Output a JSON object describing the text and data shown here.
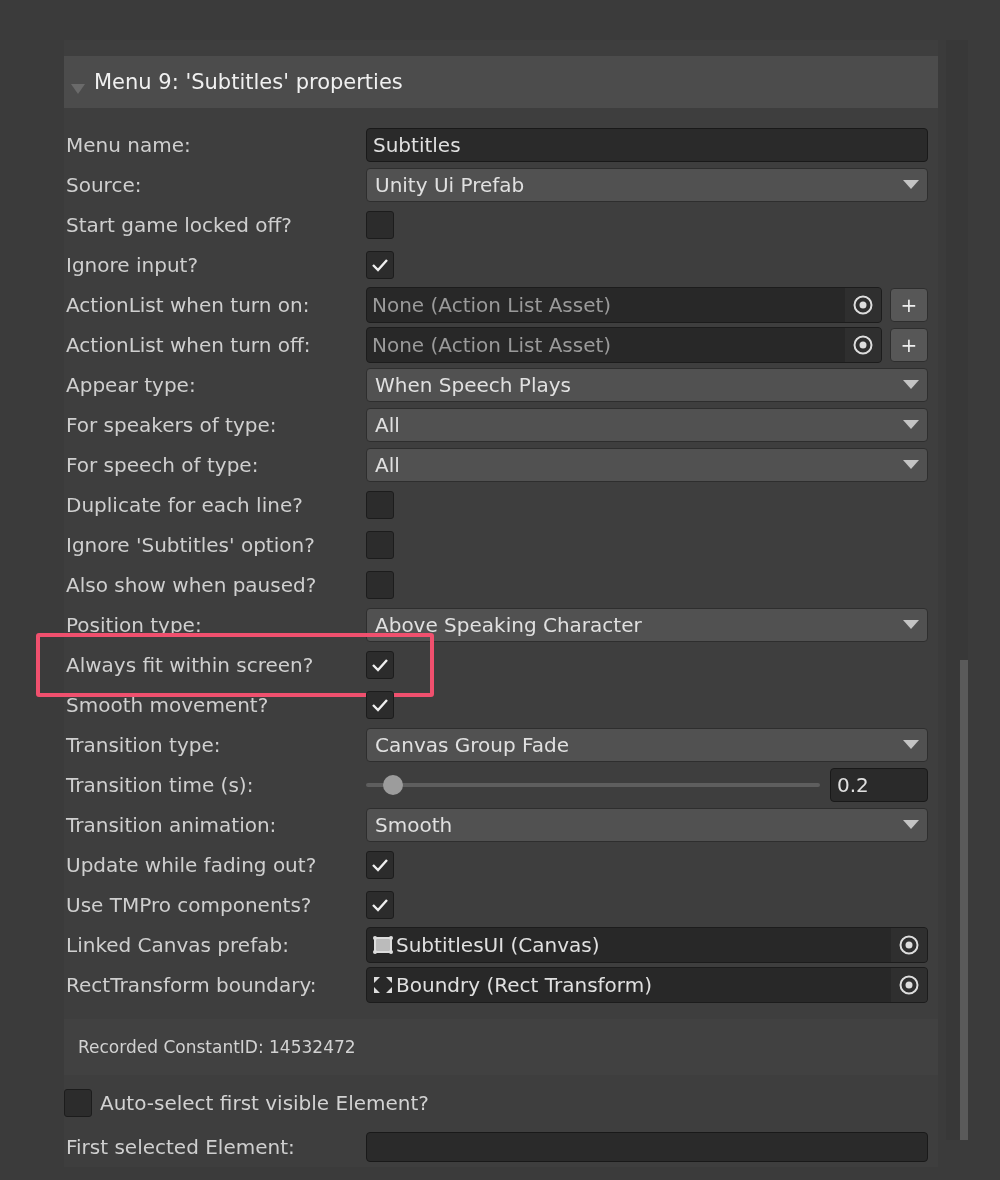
{
  "header": {
    "title": "Menu 9: 'Subtitles' properties",
    "expanded": true
  },
  "rows": [
    {
      "kind": "text",
      "label": "Menu name:",
      "value": "Subtitles"
    },
    {
      "kind": "dropdown",
      "label": "Source:",
      "value": "Unity Ui Prefab"
    },
    {
      "kind": "checkbox",
      "label": "Start game locked off?",
      "checked": false
    },
    {
      "kind": "checkbox",
      "label": "Ignore input?",
      "checked": true
    },
    {
      "kind": "object",
      "label": "ActionList when turn on:",
      "placeholder": "None (Action List Asset)",
      "button": "+"
    },
    {
      "kind": "object",
      "label": "ActionList when turn off:",
      "placeholder": "None (Action List Asset)",
      "button": "+"
    },
    {
      "kind": "dropdown",
      "label": "Appear type:",
      "value": "When Speech Plays"
    },
    {
      "kind": "dropdown",
      "label": "For speakers of type:",
      "value": "All"
    },
    {
      "kind": "dropdown",
      "label": "For speech of type:",
      "value": "All"
    },
    {
      "kind": "checkbox",
      "label": "Duplicate for each line?",
      "checked": false
    },
    {
      "kind": "checkbox",
      "label": "Ignore 'Subtitles' option?",
      "checked": false
    },
    {
      "kind": "checkbox",
      "label": "Also show when paused?",
      "checked": false
    },
    {
      "kind": "dropdown",
      "label": "Position type:",
      "value": "Above Speaking Character"
    },
    {
      "kind": "checkbox",
      "label": "Always fit within screen?",
      "checked": true,
      "highlighted": true
    },
    {
      "kind": "checkbox",
      "label": "Smooth movement?",
      "checked": true
    },
    {
      "kind": "dropdown",
      "label": "Transition type:",
      "value": "Canvas Group Fade"
    },
    {
      "kind": "slider",
      "label": "Transition time (s):",
      "level": 0.04,
      "value": "0.2"
    },
    {
      "kind": "dropdown",
      "label": "Transition animation:",
      "value": "Smooth"
    },
    {
      "kind": "checkbox",
      "label": "Update while fading out?",
      "checked": true
    },
    {
      "kind": "checkbox",
      "label": "Use TMPro components?",
      "checked": true
    },
    {
      "kind": "canvas_object",
      "label": "Linked Canvas prefab:",
      "value": "SubtitlesUI (Canvas)"
    },
    {
      "kind": "rect_object",
      "label": "RectTransform boundary:",
      "value": "Boundry (Rect Transform)"
    }
  ],
  "constant_id": "Recorded ConstantID: 14532472",
  "auto_select": {
    "label": "Auto-select first visible Element?",
    "checked": false
  },
  "first_selected": {
    "label": "First selected Element:"
  }
}
